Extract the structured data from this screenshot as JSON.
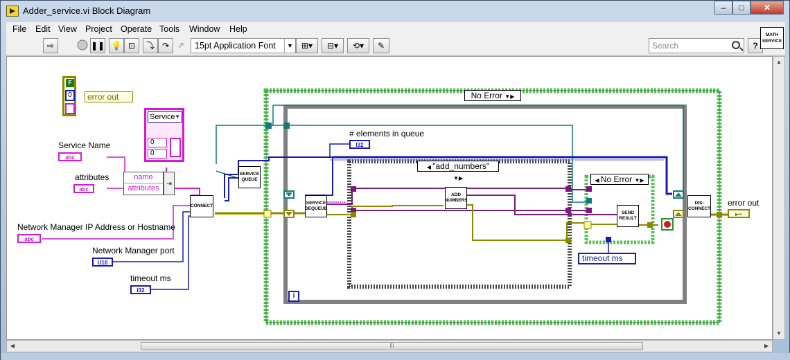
{
  "window": {
    "title": "Adder_service.vi Block Diagram",
    "minimize": "–",
    "maximize": "□",
    "close": "✕"
  },
  "menu": [
    "File",
    "Edit",
    "View",
    "Project",
    "Operate",
    "Tools",
    "Window",
    "Help"
  ],
  "toolbar": {
    "font": "15pt Application Font",
    "search_placeholder": "Search",
    "help": "?"
  },
  "vi_icon": {
    "line1": "MATH",
    "line2": "SERVICE"
  },
  "diagram": {
    "error_cluster": {
      "bool": "F",
      "code": "0",
      "label": "error out"
    },
    "service_ring": {
      "value": "Service",
      "cells": [
        "0",
        "0"
      ]
    },
    "service_name_label": "Service Name",
    "attributes_label": "attributes",
    "bundle_fields": [
      "name",
      "attributes"
    ],
    "nm_address_label": "Network Manager IP Address or Hostname",
    "nm_port_label": "Network Manager port",
    "timeout_label": "timeout ms",
    "terminal_types": {
      "str": "abc",
      "u16": "U16",
      "i32": "I32"
    },
    "subvis": {
      "connect": "CONNECT",
      "service_queue": "SERVICE QUEUE",
      "service_dequeue": "SERVICE DEQUEUE",
      "add_numbers": "ADD NUMBERS",
      "send_result": "SEND RESULT",
      "disconnect": "DIS-CONNECT"
    },
    "outer_case": "No Error",
    "inner_case": "\"add_numbers\"",
    "right_case": "No Error",
    "elements_label": "# elements in queue",
    "timeout_const": "timeout ms",
    "loop_index": "i",
    "error_out_label": "error out"
  }
}
